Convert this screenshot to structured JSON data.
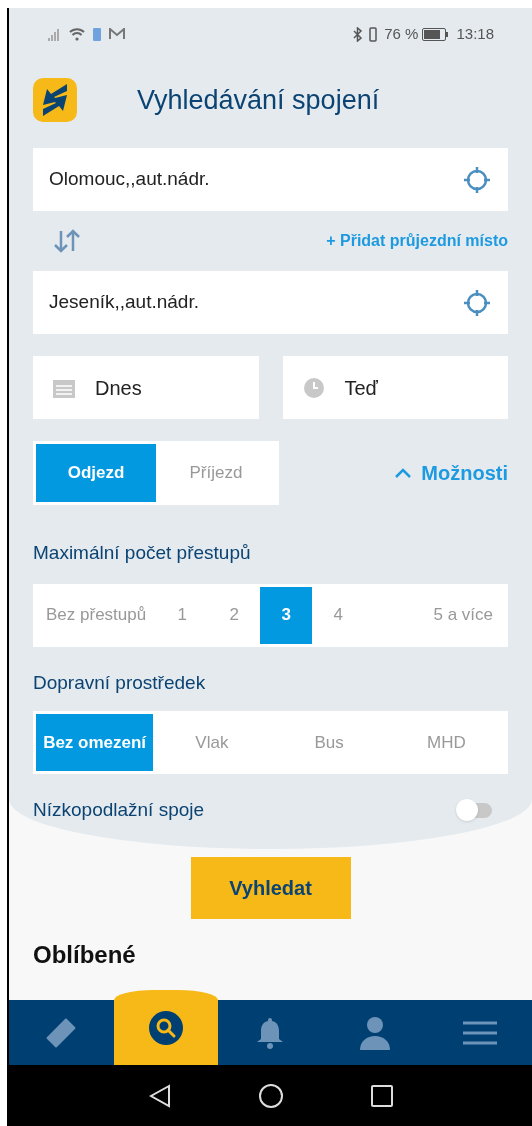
{
  "status_bar": {
    "battery": "76 %",
    "time": "13:18"
  },
  "header": {
    "title": "Vyhledávání spojení"
  },
  "from": {
    "value": "Olomouc,,aut.nádr."
  },
  "add_stop": "+ Přidat průjezdní místo",
  "to": {
    "value": "Jeseník,,aut.nádr."
  },
  "date": {
    "value": "Dnes"
  },
  "time": {
    "value": "Teď"
  },
  "direction_tabs": [
    {
      "label": "Odjezd",
      "selected": true
    },
    {
      "label": "Příjezd",
      "selected": false
    }
  ],
  "options_toggle": {
    "label": "Možnosti",
    "expanded": true
  },
  "transfers": {
    "label": "Maximální počet přestupů",
    "options": [
      {
        "label": "Bez přestupů",
        "selected": false
      },
      {
        "label": "1",
        "selected": false
      },
      {
        "label": "2",
        "selected": false
      },
      {
        "label": "3",
        "selected": true
      },
      {
        "label": "4",
        "selected": false
      },
      {
        "label": "5 a více",
        "selected": false
      }
    ]
  },
  "transport": {
    "label": "Dopravní prostředek",
    "options": [
      {
        "label": "Bez omezení",
        "selected": true
      },
      {
        "label": "Vlak",
        "selected": false
      },
      {
        "label": "Bus",
        "selected": false
      },
      {
        "label": "MHD",
        "selected": false
      }
    ]
  },
  "low_floor": {
    "label": "Nízkopodlažní spoje",
    "on": false
  },
  "search_button": "Vyhledat",
  "favorites": {
    "title": "Oblíbené"
  },
  "bottom_nav": [
    {
      "kind": "ticket",
      "selected": false
    },
    {
      "kind": "search",
      "selected": true
    },
    {
      "kind": "bell",
      "selected": false
    },
    {
      "kind": "user",
      "selected": false
    },
    {
      "kind": "menu",
      "selected": false
    }
  ]
}
